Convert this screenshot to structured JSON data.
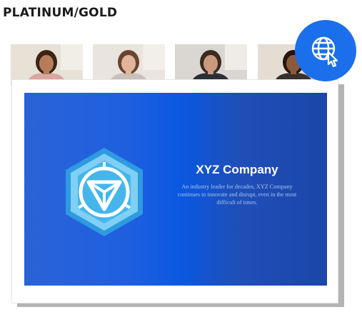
{
  "header": {
    "title": "PLATINUM/GOLD"
  },
  "participants": [
    {
      "name": "participant-1",
      "shirt": "#d9a6a0",
      "skin": "#b77d5a",
      "hair": "#3a2418",
      "bg": "#e7e1d6"
    },
    {
      "name": "participant-2",
      "shirt": "#c9c0bb",
      "skin": "#e0b59b",
      "hair": "#6a4430",
      "bg": "#e9e4dd"
    },
    {
      "name": "participant-3",
      "shirt": "#2b2f36",
      "skin": "#c99a7e",
      "hair": "#3b2b22",
      "bg": "#dad6d1"
    },
    {
      "name": "participant-4",
      "shirt": "#3a302c",
      "skin": "#8b5a3c",
      "hair": "#24160f",
      "bg": "#e5ddd2"
    }
  ],
  "slide": {
    "company_name": "XYZ Company",
    "tagline": "An industry leader for decades, XYZ Company continues to innovate and disrupt, even in the most difficult of times."
  },
  "badge": {
    "icon": "globe-cursor-icon",
    "color": "#1b6fea"
  },
  "colors": {
    "slide_start": "#2a63d6",
    "slide_mid": "#0a58e0",
    "slide_end": "#1c46a8",
    "logo_light": "#8ad4f5",
    "logo_mid": "#3ab0ea"
  }
}
